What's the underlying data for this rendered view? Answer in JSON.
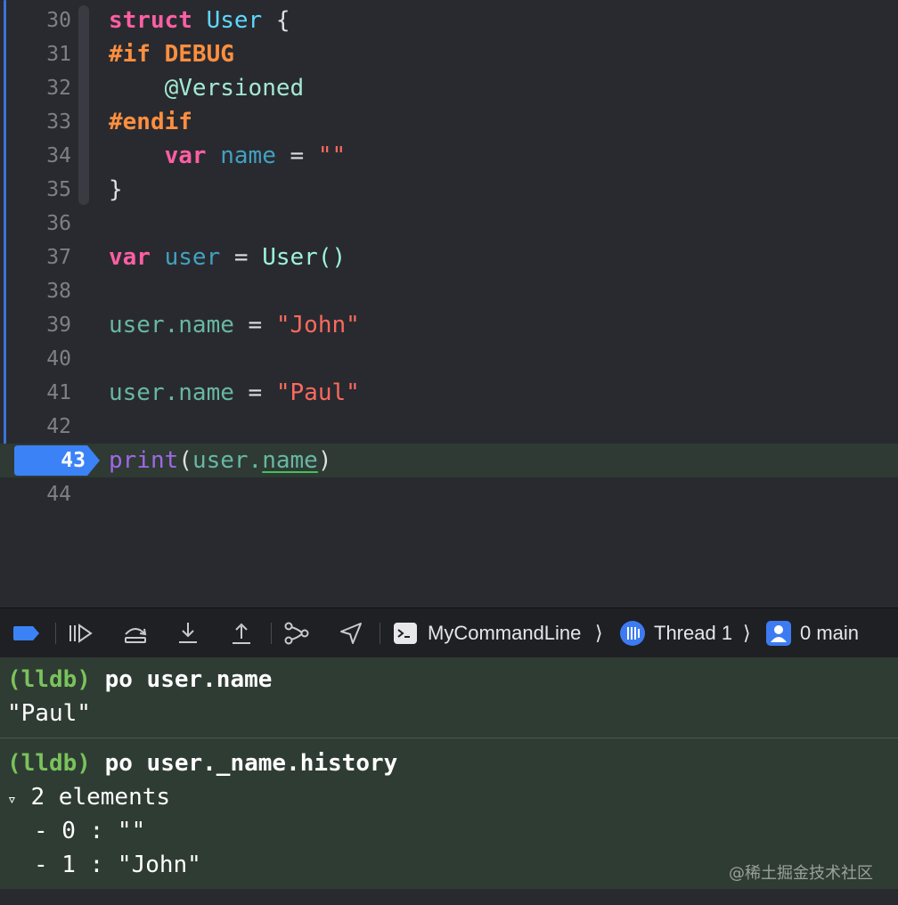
{
  "editor": {
    "lines": [
      {
        "num": "30"
      },
      {
        "num": "31"
      },
      {
        "num": "32"
      },
      {
        "num": "33"
      },
      {
        "num": "34"
      },
      {
        "num": "35"
      },
      {
        "num": "36"
      },
      {
        "num": "37"
      },
      {
        "num": "38"
      },
      {
        "num": "39"
      },
      {
        "num": "40"
      },
      {
        "num": "41"
      },
      {
        "num": "42"
      },
      {
        "num": "43"
      },
      {
        "num": "44"
      }
    ],
    "tokens": {
      "l30": [
        "struct",
        "User",
        "{"
      ],
      "l31": [
        "#if",
        "DEBUG"
      ],
      "l32": [
        "@Versioned"
      ],
      "l33": [
        "#endif"
      ],
      "l34": [
        "var",
        "name",
        "=",
        "\"\""
      ],
      "l35": [
        "}"
      ],
      "l37": [
        "var",
        "user",
        "=",
        "User()"
      ],
      "l39": [
        "user.name",
        "=",
        "\"John\""
      ],
      "l41": [
        "user.name",
        "=",
        "\"Paul\""
      ],
      "l43": [
        "print",
        "(",
        "user.",
        "name",
        ")"
      ]
    },
    "current_line": "43"
  },
  "debug_bar": {
    "process": "MyCommandLine",
    "thread": "Thread 1",
    "frame": "0 main",
    "icons": [
      "breakpoints-toggle-icon",
      "continue-icon",
      "step-over-icon",
      "step-into-icon",
      "step-out-icon",
      "view-hierarchy-icon",
      "simulate-location-icon",
      "terminal-icon",
      "thread-icon",
      "frame-person-icon"
    ]
  },
  "console": {
    "prompt": "(lldb)",
    "cmd1": "po user.name",
    "out1": "\"Paul\"",
    "cmd2": "po user._name.history",
    "out2_head": "2 elements",
    "out2_items": [
      "- 0 : \"\"",
      "- 1 : \"John\""
    ],
    "disclosure": "▿"
  },
  "colors": {
    "editor_bg": "#292a30",
    "keyword": "#fc5fa3",
    "type": "#5dd8ff",
    "string": "#fc6a5d",
    "preprocessor": "#fd8f3f",
    "breakpoint": "#3b82f6",
    "console_bg": "#2f3c34",
    "prompt": "#7ac35b"
  },
  "watermark": "@稀土掘金技术社区"
}
